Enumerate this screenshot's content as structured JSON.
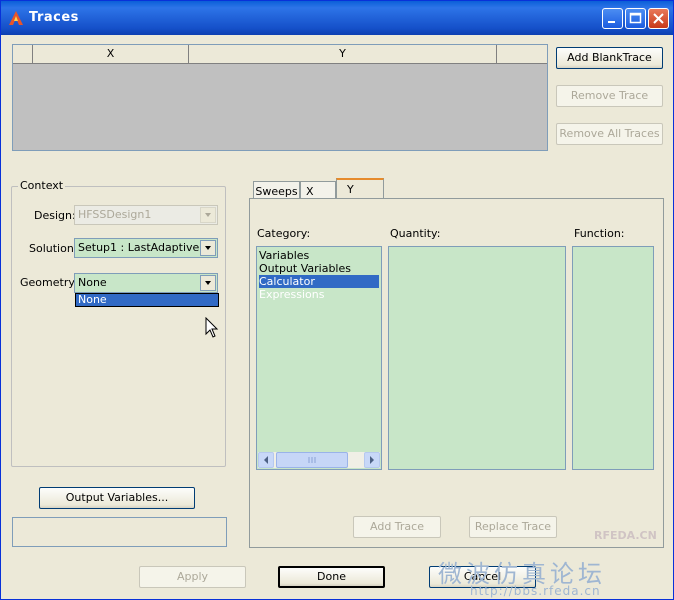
{
  "window": {
    "title": "Traces",
    "minimize_icon": "minimize-icon",
    "maximize_icon": "maximize-icon",
    "close_icon": "close-icon"
  },
  "trace_table": {
    "columns": [
      "",
      "X",
      "Y",
      ""
    ]
  },
  "trace_buttons": {
    "add_blank": "Add BlankTrace",
    "remove": "Remove Trace",
    "remove_all": "Remove All Traces"
  },
  "context": {
    "legend": "Context",
    "design_label": "Design:",
    "design_value": "HFSSDesign1",
    "solution_label": "Solution:",
    "solution_value": "Setup1 : LastAdaptive",
    "geometry_label": "Geometry:",
    "geometry_value": "None",
    "geometry_dropdown_option": "None",
    "output_variables_button": "Output Variables..."
  },
  "tabs": [
    {
      "label": "Sweeps"
    },
    {
      "label": "X"
    },
    {
      "label": "Y"
    }
  ],
  "active_tab": "Y",
  "panel": {
    "category_label": "Category:",
    "quantity_label": "Quantity:",
    "function_label": "Function:",
    "categories": [
      "Variables",
      "Output Variables",
      "Calculator Expressions"
    ],
    "selected_category": "Calculator Expressions",
    "add_trace": "Add Trace",
    "replace_trace": "Replace Trace"
  },
  "footer": {
    "apply": "Apply",
    "done": "Done",
    "cancel": "Cancel"
  },
  "watermark": {
    "brand": "RFEDA.CN",
    "forum": "微波仿真论坛",
    "url": "http://bbs.rfeda.cn"
  },
  "colors": {
    "title_bar": "#1550c9",
    "list_background": "#c8e6c8",
    "selection": "#316ac5",
    "dialog_face": "#ece9d8"
  }
}
